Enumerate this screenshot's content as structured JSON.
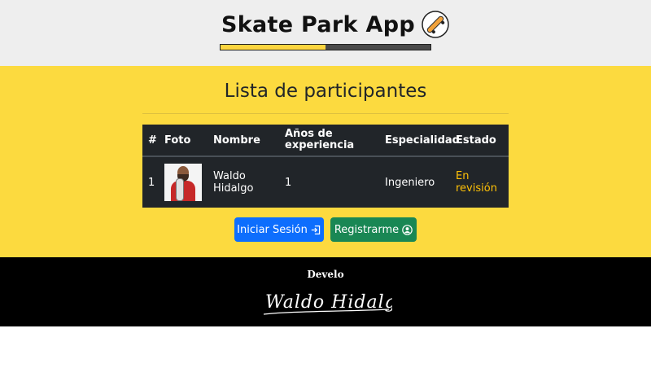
{
  "header": {
    "title": "Skate Park App",
    "logo_icon": "skateboard-icon",
    "progress": 0.5,
    "progress_color": "#fcd53f"
  },
  "main": {
    "title": "Lista de participantes",
    "background": "#fcda3f",
    "table": {
      "columns": [
        "#",
        "Foto",
        "Nombre",
        "Años de experiencia",
        "Especialidad",
        "Estado"
      ],
      "rows": [
        {
          "id": "1",
          "photo": "participant-photo",
          "name": "Waldo Hidalgo",
          "experience": "1",
          "specialty": "Ingeniero",
          "status": "En revisión"
        }
      ]
    },
    "buttons": {
      "login_label": "Iniciar Sesión",
      "login_icon": "sign-in-icon",
      "register_label": "Registrarme",
      "register_icon": "user-circle-icon"
    }
  },
  "footer": {
    "label": "Develo",
    "signature": "Waldo Hidalgo"
  },
  "colors": {
    "login_button": "#0d6efd",
    "register_button": "#198754",
    "status": "#ffc107"
  }
}
